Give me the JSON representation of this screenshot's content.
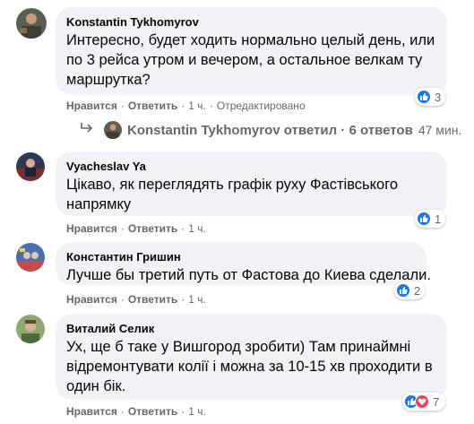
{
  "comments": [
    {
      "author": "Konstantin Tykhomyrov",
      "text": "Интересно, будет ходить нормально целый день, или по 3 рейса утром и вечером, а остальное велкам ту маршрутка?",
      "like_label": "Нравится",
      "reply_label": "Ответить",
      "time": "1 ч.",
      "edited": "Отредактировано",
      "reaction_count": "3"
    },
    {
      "author": "Vyacheslav Ya",
      "text": "Цікаво, як переглядять графік руху Фастівського напрямку",
      "like_label": "Нравится",
      "reply_label": "Ответить",
      "time": "1 ч.",
      "reaction_count": "1"
    },
    {
      "author": "Константин Гришин",
      "text": "Лучше бы третий путь от Фастова до Киева сделали.",
      "like_label": "Нравится",
      "reply_label": "Ответить",
      "time": "1 ч.",
      "reaction_count": "2"
    },
    {
      "author": "Виталий Селик",
      "text": "Ух, ще б таке у Вишгород зробити) Там принаймні відремонтувати колії і можна за 10-15 хв проходити в один бік.",
      "like_label": "Нравится",
      "reply_label": "Ответить",
      "time": "1 ч.",
      "reaction_count": "7"
    }
  ],
  "reply_summary": {
    "text": "Konstantin Tykhomyrov ответил · 6 ответов",
    "time": "47 мин."
  },
  "colors": {
    "bubble": "#f0f2f5",
    "meta": "#65676b",
    "like": "#1877f2",
    "love": "#f33e58"
  },
  "icons": {
    "reply_arrow": "reply-arrow-icon",
    "like": "like-icon",
    "love": "love-icon"
  }
}
